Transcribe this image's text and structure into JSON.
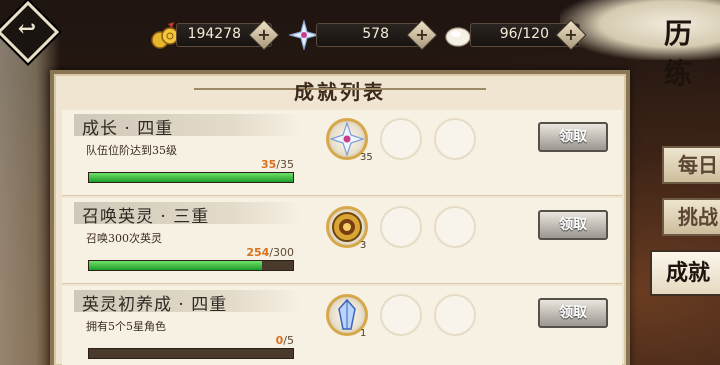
{
  "currencies": [
    {
      "icon": "gold-coin-icon",
      "value": "194278"
    },
    {
      "icon": "star-crystal-icon",
      "value": "578"
    },
    {
      "icon": "stamina-bun-icon",
      "value": "96/120"
    }
  ],
  "side_title": "历练",
  "tabs": [
    {
      "label": "每日",
      "active": false
    },
    {
      "label": "挑战",
      "active": false
    },
    {
      "label": "成就",
      "active": true
    }
  ],
  "panel_title": "成就列表",
  "achievements": [
    {
      "name": "成长 · 四重",
      "desc": "队伍位阶达到35级",
      "progress": {
        "current": "35",
        "max": "/35",
        "fraction": 1.0
      },
      "reward": {
        "icon": "star-crystal-icon",
        "count": "35"
      },
      "button": "领取"
    },
    {
      "name": "召唤英灵 · 三重",
      "desc": "召唤300次英灵",
      "progress": {
        "current": "254",
        "max": "/300",
        "fraction": 0.847
      },
      "reward": {
        "icon": "golden-coin-item-icon",
        "count": "3"
      },
      "button": "领取"
    },
    {
      "name": "英灵初养成 · 四重",
      "desc": "拥有5个5星角色",
      "progress": {
        "current": "0",
        "max": "/5",
        "fraction": 0.0
      },
      "reward": {
        "icon": "blue-crystal-icon",
        "count": "1"
      },
      "button": "领取"
    }
  ],
  "colors": {
    "accent_orange": "#d6711d",
    "bar_green": "#2fb83a",
    "panel_bg": "#efe5d0"
  }
}
